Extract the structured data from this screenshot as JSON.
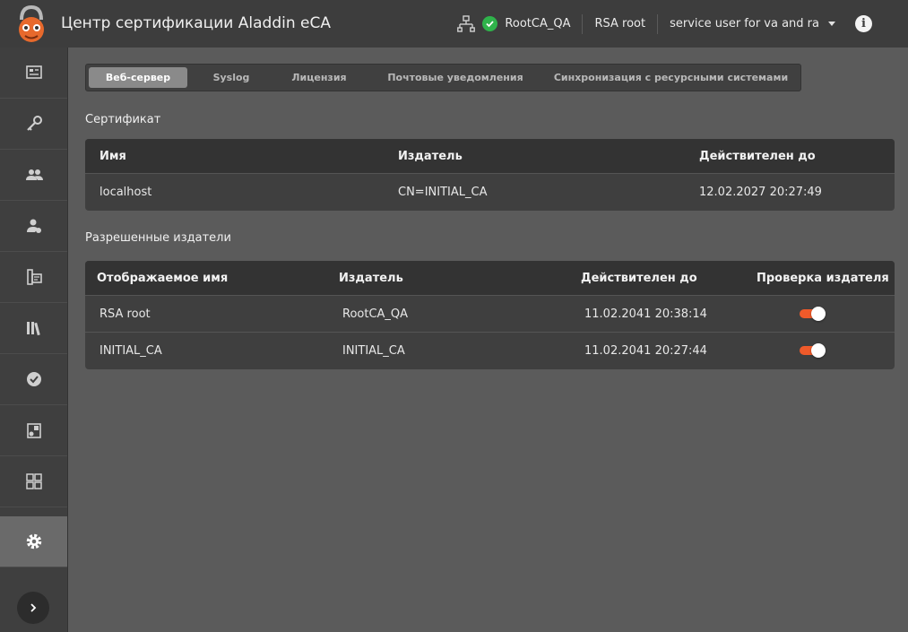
{
  "header": {
    "title": "Центр сертификации Aladdin eCA",
    "ca_name": "RootCA_QA",
    "profile": "RSA root",
    "user": "service user for va and ra"
  },
  "sidebar": {
    "items": [
      {
        "icon": "dashboard-icon"
      },
      {
        "icon": "key-icon"
      },
      {
        "icon": "users-icon"
      },
      {
        "icon": "user-admin-icon"
      },
      {
        "icon": "certificate-profile-icon"
      },
      {
        "icon": "library-icon"
      },
      {
        "icon": "approved-icon"
      },
      {
        "icon": "templates-icon"
      },
      {
        "icon": "calculator-icon"
      },
      {
        "icon": "settings-icon",
        "active": true
      }
    ]
  },
  "tabs": [
    {
      "label": "Веб-сервер",
      "active": true
    },
    {
      "label": "Syslog"
    },
    {
      "label": "Лицензия"
    },
    {
      "label": "Почтовые уведомления"
    },
    {
      "label": "Синхронизация с ресурсными системами"
    }
  ],
  "certificate": {
    "title": "Сертификат",
    "columns": [
      "Имя",
      "Издатель",
      "Действителен до"
    ],
    "rows": [
      {
        "name": "localhost",
        "issuer": "CN=INITIAL_CA",
        "valid_to": "12.02.2027 20:27:49"
      }
    ]
  },
  "issuers": {
    "title": "Разрешенные издатели",
    "columns": [
      "Отображаемое имя",
      "Издатель",
      "Действителен до",
      "Проверка издателя"
    ],
    "rows": [
      {
        "display_name": "RSA root",
        "issuer": "RootCA_QA",
        "valid_to": "11.02.2041 20:38:14",
        "check": true
      },
      {
        "display_name": "INITIAL_CA",
        "issuer": "INITIAL_CA",
        "valid_to": "11.02.2041 20:27:44",
        "check": true
      }
    ]
  },
  "colors": {
    "accent": "#ef5a2a",
    "status_ok": "#2fb34b",
    "header_bg": "#3d3d3d",
    "content_bg": "#5b5b5b"
  }
}
